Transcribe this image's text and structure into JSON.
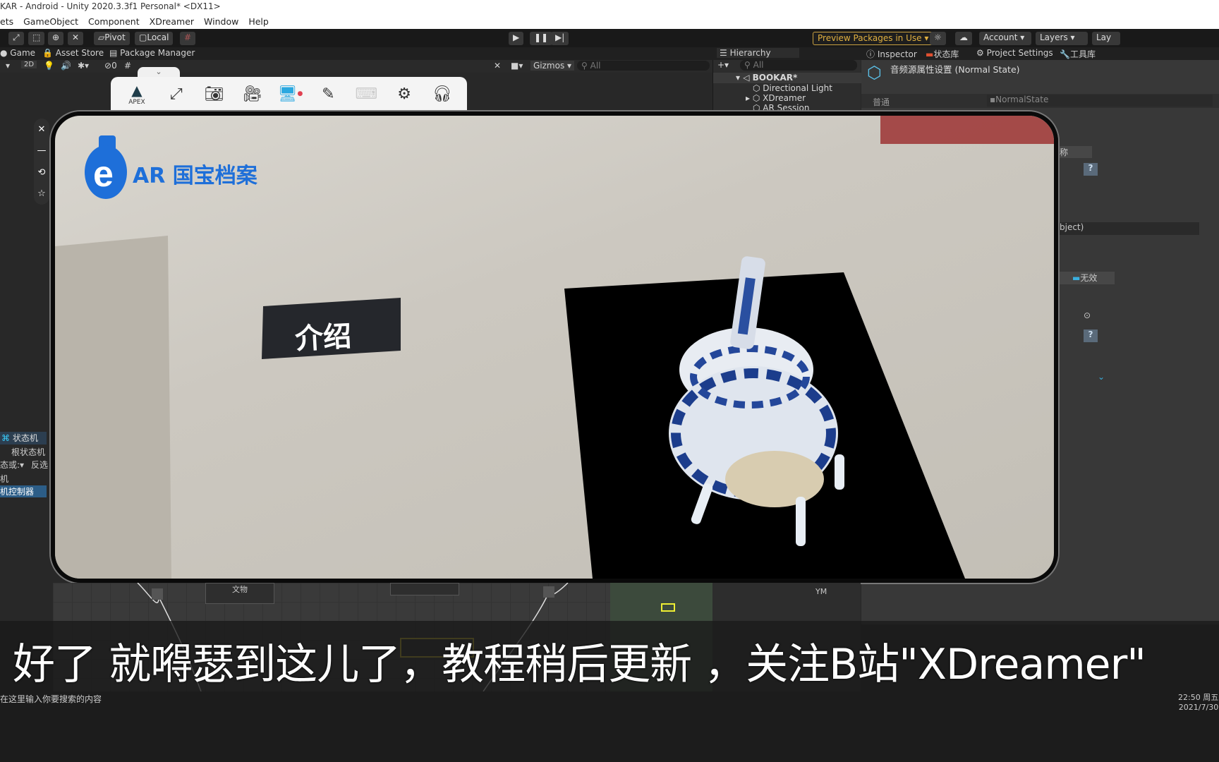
{
  "window": {
    "title": "KAR - Android - Unity 2020.3.3f1 Personal* <DX11>"
  },
  "menu": [
    "ets",
    "GameObject",
    "Component",
    "XDreamer",
    "Window",
    "Help"
  ],
  "toolbar": {
    "pivot": "Pivot",
    "local": "Local",
    "preview_packages": "Preview Packages in Use",
    "account": "Account",
    "layers": "Layers",
    "layout": "Lay"
  },
  "tabs": {
    "game": "Game",
    "asset_store": "Asset Store",
    "package_manager": "Package Manager",
    "hierarchy": "Hierarchy",
    "inspector": "Inspector",
    "state_lib": "状态库",
    "project_settings": "Project Settings",
    "toolbox": "工具库"
  },
  "scenebar": {
    "mode_2d": "2D",
    "hidden_count": "0",
    "gizmos": "Gizmos",
    "search_placeholder": "All"
  },
  "hierarchy": {
    "search_placeholder": "All",
    "scene": "BOOKAR*",
    "items": [
      "Directional Light",
      "XDreamer",
      "AR Session"
    ]
  },
  "inspector": {
    "title": "音频源属性设置 (Normal State)",
    "general_label": "普通",
    "state_field": "NormalState",
    "name_col": "称",
    "object_field": "bject)",
    "invalid_label": "无效"
  },
  "left_panel": {
    "state_machine": "状态机",
    "root_state_machine": "根状态机",
    "dropdown": "态或:",
    "invert": "反选",
    "item1": "机",
    "item2": "机控制器"
  },
  "float_toolbar": {
    "brand": "APEX",
    "icons": [
      "fullscreen-icon",
      "camera-icon",
      "video-record-icon",
      "screen-cast-icon",
      "brush-icon",
      "keyboard-icon",
      "settings-icon",
      "headset-icon"
    ]
  },
  "phone": {
    "logo_text": "AR 国宝档案",
    "label": "介绍"
  },
  "nodegraph": {
    "node1": "文物",
    "ym": "YM"
  },
  "subtitle": "好了 就嘚瑟到这儿了，教程稍后更新 ，关注B站\"XDreamer\"",
  "taskbar": {
    "search_placeholder": "在这里输入你要搜索的内容",
    "time": "22:50 周五",
    "date": "2021/7/30"
  },
  "colors": {
    "accent_blue": "#1e6fd9",
    "preview_packages": "#e0b040",
    "selection": "#2c5d87"
  }
}
